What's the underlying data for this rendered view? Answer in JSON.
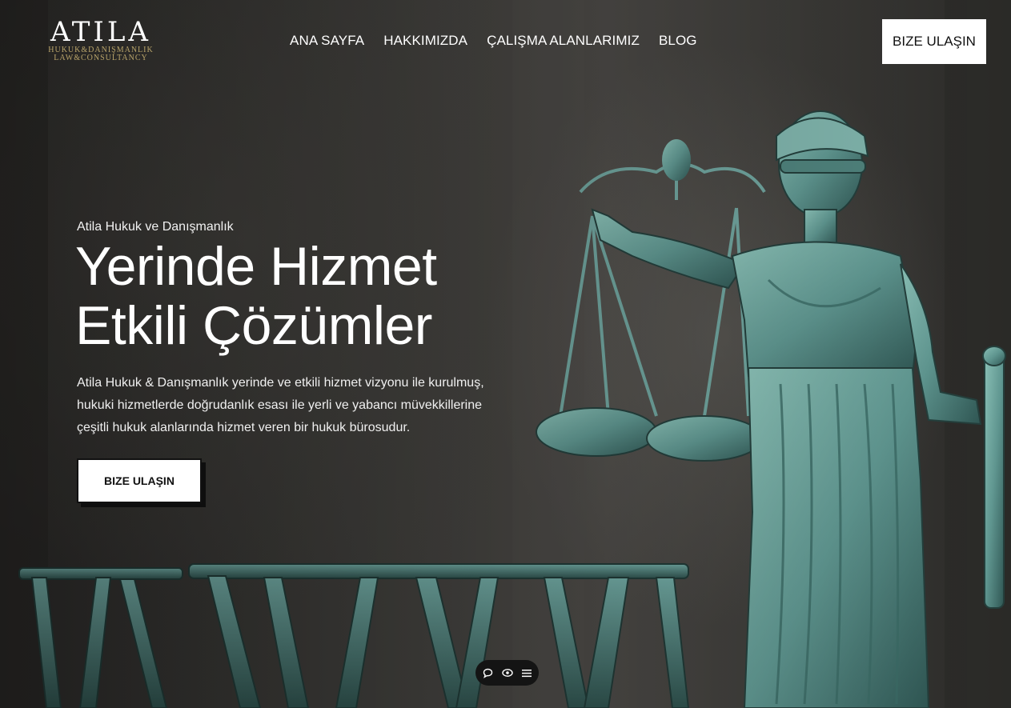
{
  "logo": {
    "name": "ATILA",
    "sub1": "HUKUK&DANIŞMANLIK",
    "sub2": "LAW&CONSULTANCY"
  },
  "nav": {
    "items": [
      {
        "label": "ANA SAYFA"
      },
      {
        "label": "HAKKIMIZDA"
      },
      {
        "label": "ÇALIŞMA ALANLARIMIZ"
      },
      {
        "label": "BLOG"
      }
    ],
    "cta_label": "BIZE ULAŞIN"
  },
  "hero": {
    "eyebrow": "Atila Hukuk ve Danışmanlık",
    "headline_line1": "Yerinde Hizmet",
    "headline_line2": "Etkili Çözümler",
    "description_lines": [
      "Atila Hukuk & Danışmanlık yerinde ve etkili hizmet vizyonu ile kurulmuş,",
      "hukuki hizmetlerde doğrudanlık esası ile yerli ve yabancı müvekkillerine",
      "çeşitli hukuk alanlarında hizmet veren bir hukuk bürosudur."
    ],
    "cta_label": "BIZE ULAŞIN",
    "image": "lady-justice-statue"
  },
  "floating_toolbar": {
    "icons": [
      "chat-bubble-icon",
      "eye-icon",
      "menu-icon"
    ]
  },
  "colors": {
    "statue_patina": "#5f9690",
    "logo_gold": "#b9a46a",
    "cta_bg": "#ffffff"
  }
}
